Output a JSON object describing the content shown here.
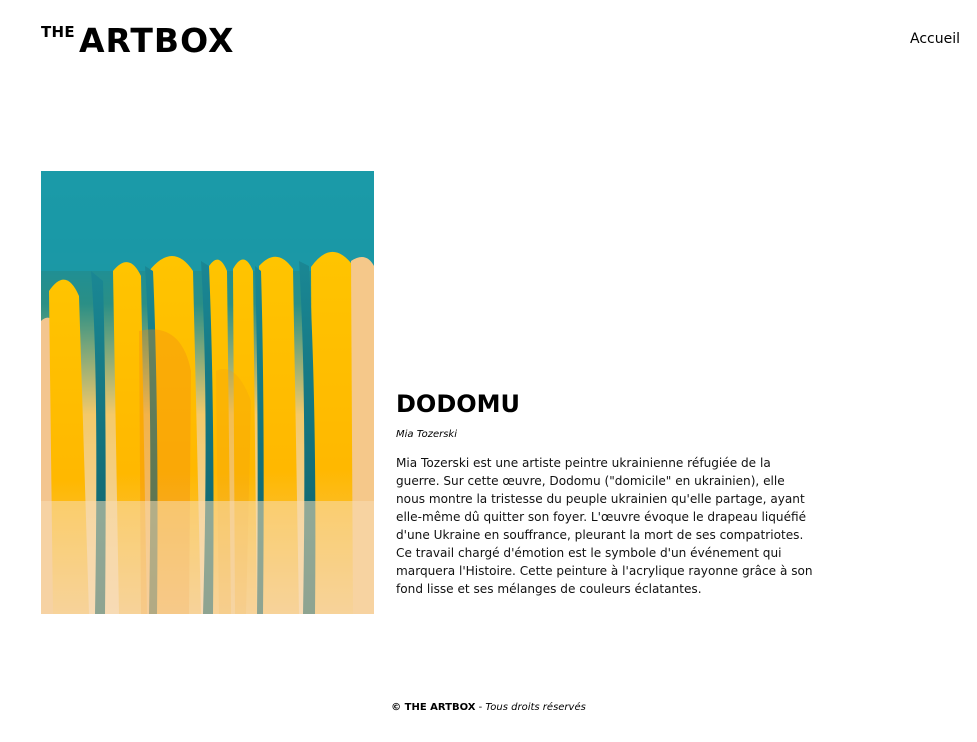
{
  "header": {
    "logo_small": "THE",
    "logo_big": "ARTBOX",
    "nav_label": "Accueil"
  },
  "artwork": {
    "image_icon": "abstract-painting-image",
    "title": "DODOMU",
    "author": "Mia Tozerski",
    "description": "Mia Tozerski est une artiste peintre ukrainienne réfugiée de la guerre. Sur cette œuvre, Dodomu (\"domicile\" en ukrainien), elle nous montre la tristesse du peuple ukrainien qu'elle partage, ayant elle-même dû quitter son foyer. L'œuvre évoque le drapeau liquéfié d'une Ukraine en souffrance, pleurant la mort de ses compatriotes. Ce travail chargé d'émotion est le symbole d'un événement qui marquera l'Histoire. Cette peinture à l'acrylique rayonne grâce à son fond lisse et ses mélanges de couleurs éclatantes."
  },
  "footer": {
    "brand": "© THE ARTBOX",
    "separator": " - ",
    "rights": "Tous droits réservés"
  },
  "colors": {
    "teal": "#1b98a6",
    "yellow": "#ffbe00",
    "cream": "#f7dcb4",
    "orange": "#f09a10"
  }
}
